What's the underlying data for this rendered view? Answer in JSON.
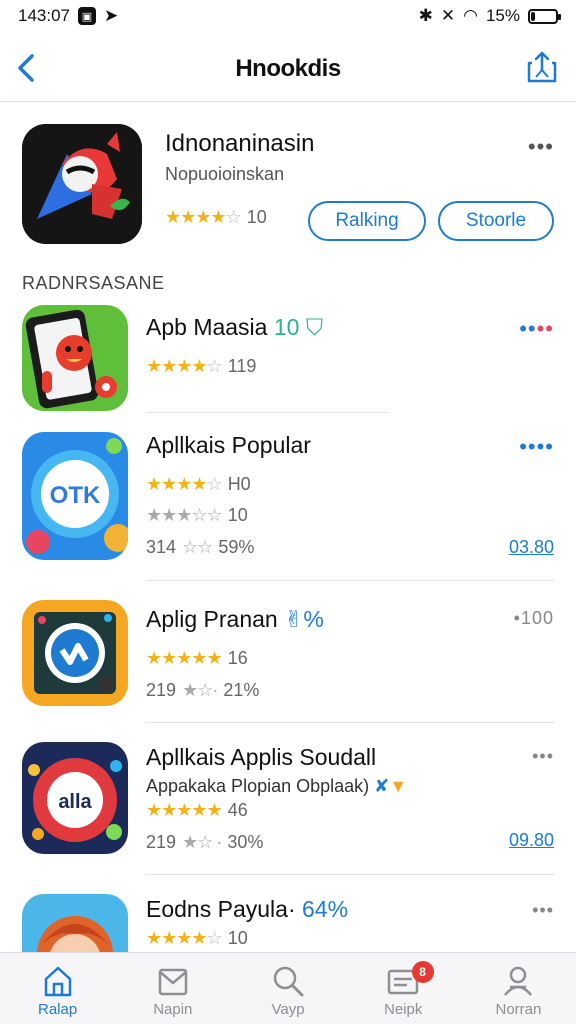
{
  "status": {
    "time": "143:07",
    "battery": "15%",
    "battery_level": 0.15
  },
  "nav": {
    "title": "Hnookdis"
  },
  "featured": {
    "name": "Idnonaninasin",
    "subtitle": "Nopuoioinskan",
    "rating_text": "10",
    "stars": 3.5,
    "more": "•••",
    "button1": "Ralking",
    "button2": "Stoorle"
  },
  "section": {
    "label": "RADNRSASANE"
  },
  "apps": [
    {
      "name": "Apb Maasia",
      "badge": "10",
      "stars": 3.5,
      "rating_text": "119",
      "dots": "••••"
    },
    {
      "name": "Apllkais Popular",
      "stars": 3.5,
      "rating_text": "H0",
      "line2": "10",
      "line3_prefix": "314",
      "line3": "59%",
      "price": "03.80",
      "dots": "••••"
    },
    {
      "name": "Aplig Pranan",
      "suffix": "%",
      "stars": 4.5,
      "rating_text": "16",
      "line3_prefix": "219",
      "line3": "21%",
      "dots": "•100"
    },
    {
      "name": "Apllkais Applis Soudall",
      "sub": "Appakaka Plopian Obplaak)",
      "stars": 4.5,
      "rating_text": "46",
      "line3_prefix": "219",
      "line3": "30%",
      "price": "09.80",
      "dots": "•••"
    },
    {
      "name": "Eodns Payula",
      "suffix": "64%",
      "stars": 3.5,
      "rating_text": "10",
      "dots": "•••"
    }
  ],
  "tabs": [
    {
      "label": "Ralap",
      "icon": "home-icon"
    },
    {
      "label": "Napin",
      "icon": "mail-icon"
    },
    {
      "label": "Vayp",
      "icon": "search-icon"
    },
    {
      "label": "Neipk",
      "icon": "updates-icon",
      "badge": "8"
    },
    {
      "label": "Norran",
      "icon": "account-icon"
    }
  ],
  "colors": {
    "accent": "#1f7bd1",
    "star": "#f3b21a",
    "badge": "#e53935"
  }
}
